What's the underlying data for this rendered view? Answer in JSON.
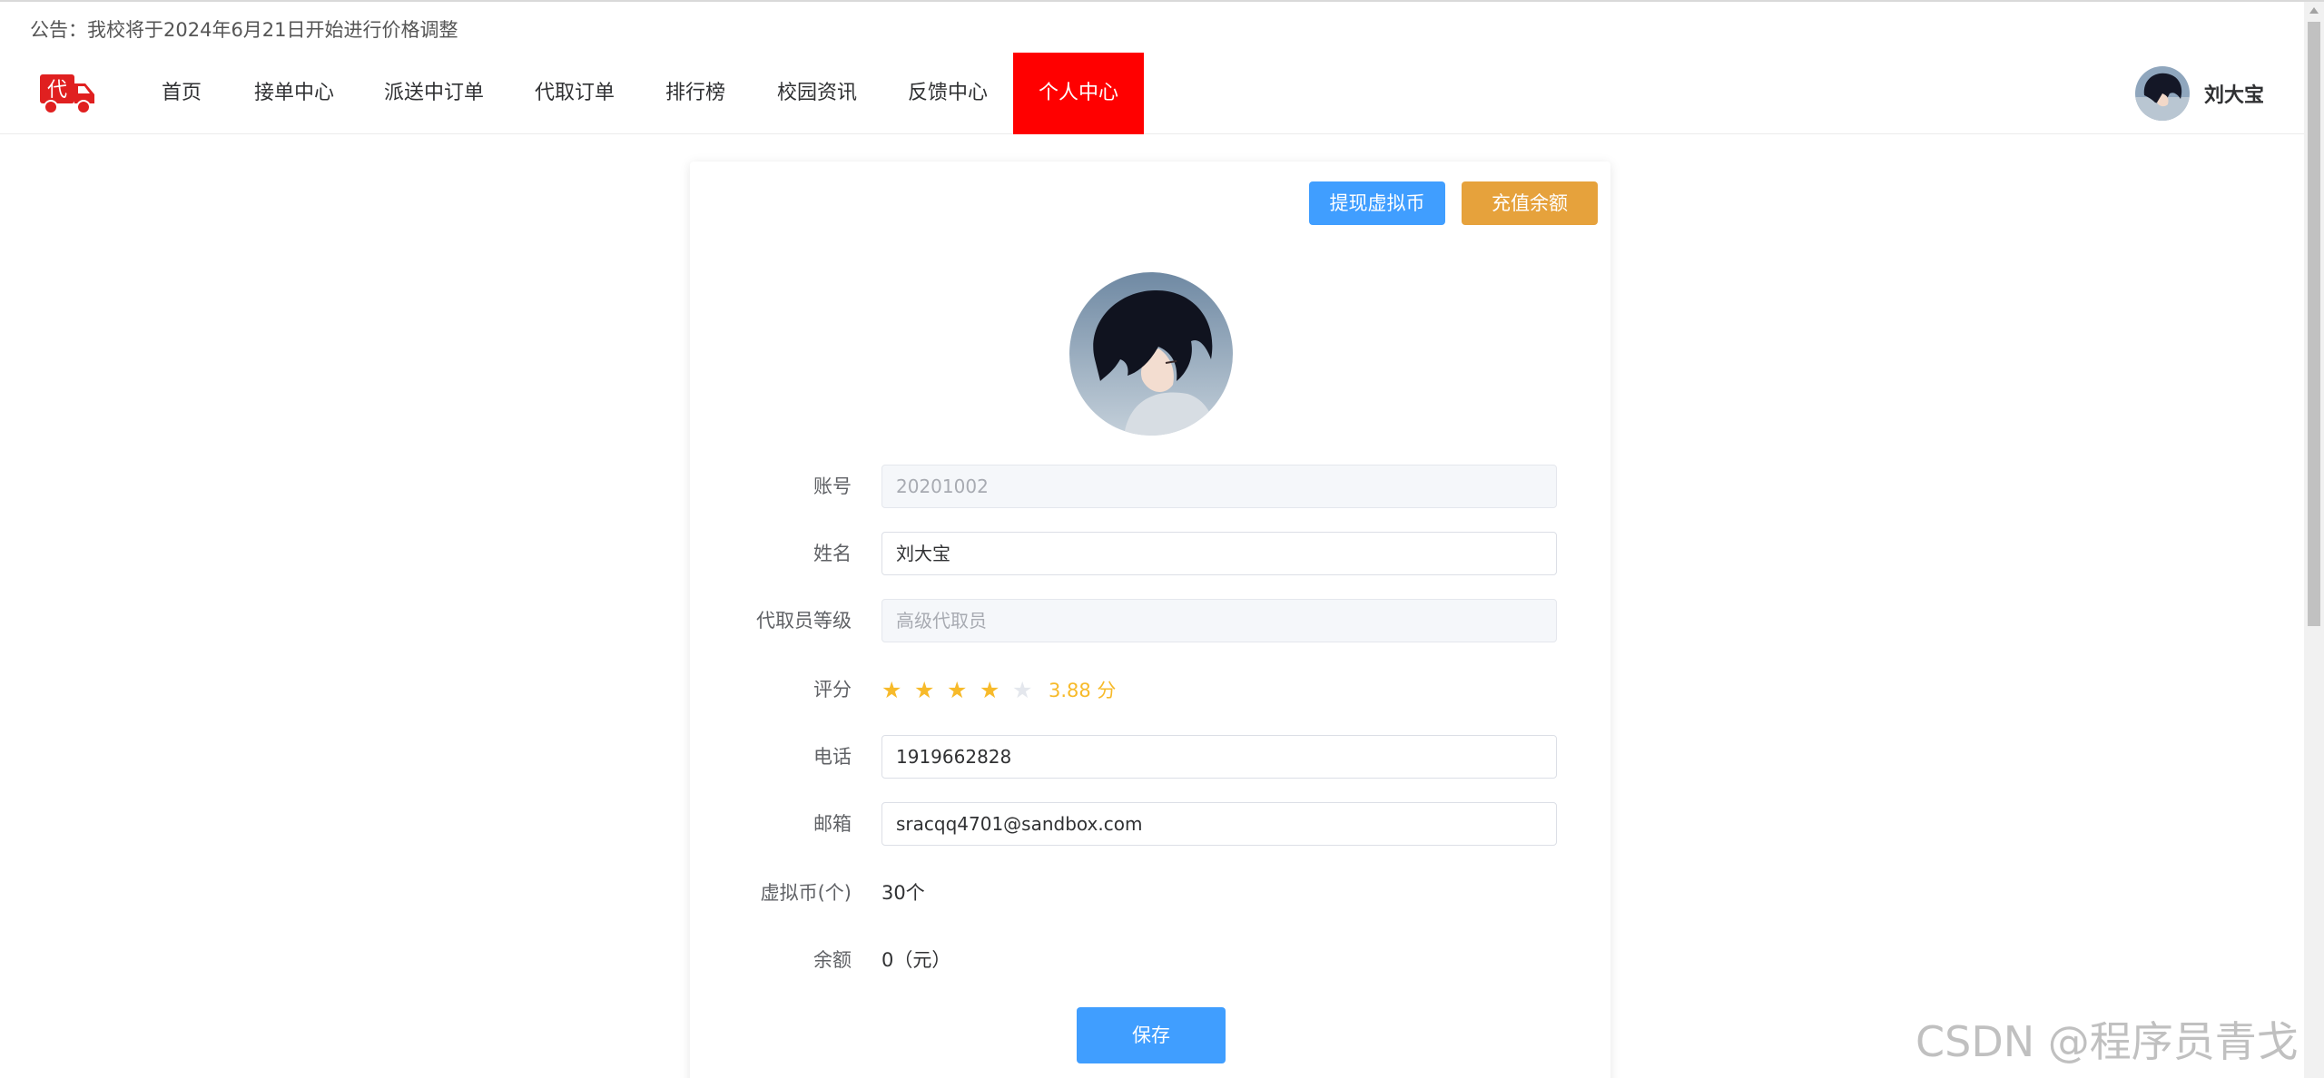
{
  "notice": "公告：我校将于2024年6月21日开始进行价格调整",
  "logo": {
    "char": "代",
    "icon": "delivery-truck-icon",
    "color": "#e02020"
  },
  "nav": {
    "items": [
      {
        "label": "首页"
      },
      {
        "label": "接单中心"
      },
      {
        "label": "派送中订单"
      },
      {
        "label": "代取订单"
      },
      {
        "label": "排行榜"
      },
      {
        "label": "校园资讯"
      },
      {
        "label": "反馈中心"
      },
      {
        "label": "个人中心",
        "active": true
      }
    ],
    "active_color": "#ff0000"
  },
  "user": {
    "name": "刘大宝"
  },
  "actions": {
    "withdraw_label": "提现虚拟币",
    "recharge_label": "充值余额"
  },
  "profile": {
    "account": {
      "label": "账号",
      "value": "20201002"
    },
    "name": {
      "label": "姓名",
      "value": "刘大宝"
    },
    "level": {
      "label": "代取员等级",
      "value": "高级代取员"
    },
    "rating": {
      "label": "评分",
      "value": 3.88,
      "text": "3.88 分",
      "max": 5
    },
    "phone": {
      "label": "电话",
      "value": "1919662828"
    },
    "email": {
      "label": "邮箱",
      "value": "sracqq4701@sandbox.com"
    },
    "coins": {
      "label": "虚拟币(个)",
      "value": "30个"
    },
    "balance": {
      "label": "余额",
      "value": "0（元）"
    }
  },
  "save_label": "保存",
  "watermark": "CSDN @程序员青戈",
  "colors": {
    "primary": "#409eff",
    "warning": "#e6a23c",
    "star": "#f7ba2a"
  }
}
